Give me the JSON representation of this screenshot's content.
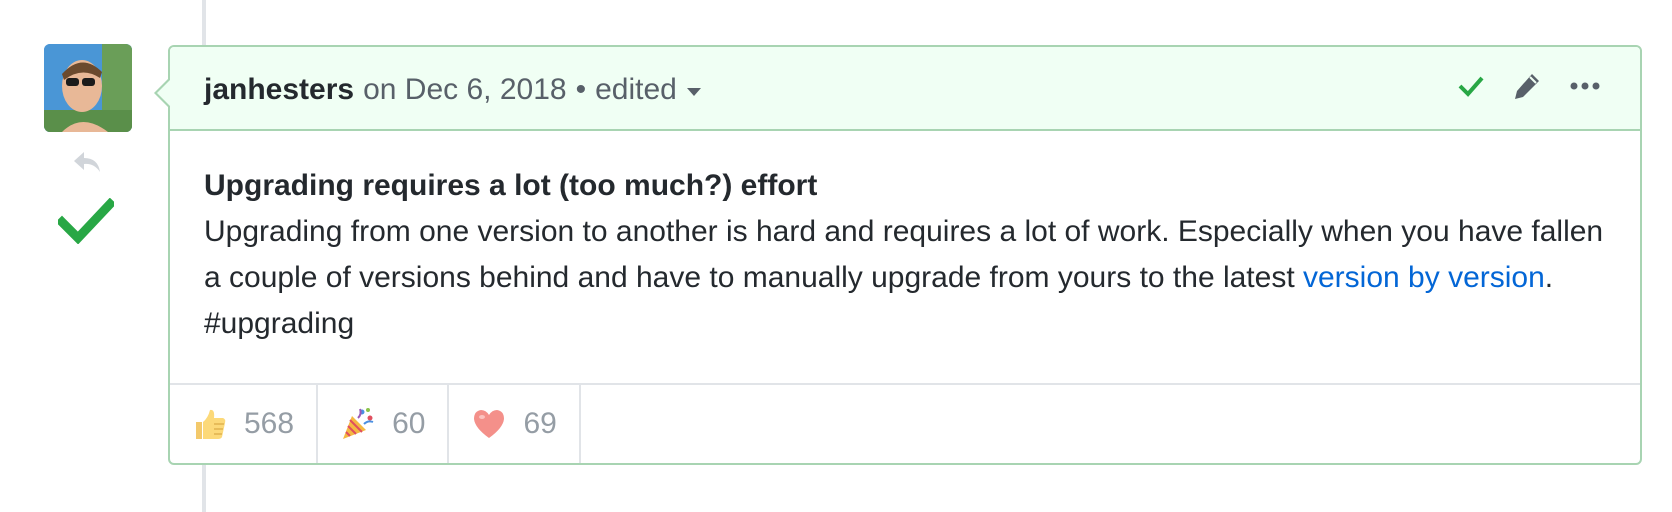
{
  "comment": {
    "author": "janhesters",
    "date": "on Dec 6, 2018",
    "separator": "•",
    "edited_label": "edited",
    "title": "Upgrading requires a lot (too much?) effort",
    "body_text": "Upgrading from one version to another is hard and requires a lot of work. Especially when you have fallen a couple of versions behind and have to manually upgrade from yours to the latest ",
    "link_text": "version by version",
    "body_suffix": ". #upgrading"
  },
  "reactions": [
    {
      "icon": "thumbs-up-icon",
      "count": "568"
    },
    {
      "icon": "party-popper-icon",
      "count": "60"
    },
    {
      "icon": "heart-icon",
      "count": "69"
    }
  ],
  "colors": {
    "header_bg": "#f0fff4",
    "border": "#a8d4b2",
    "check": "#28a745",
    "link": "#0366d6"
  }
}
